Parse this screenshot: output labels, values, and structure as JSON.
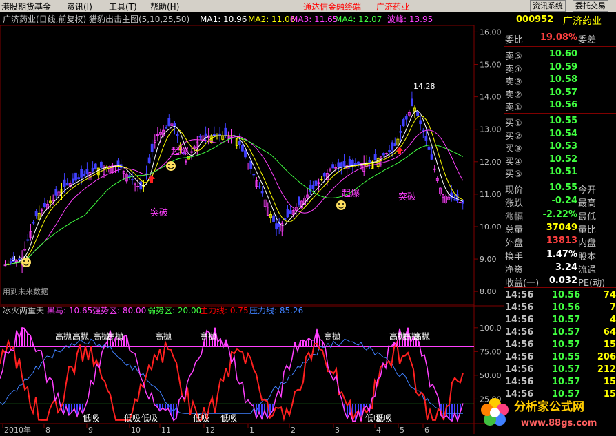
{
  "menu": {
    "items": [
      "港股期货基金",
      "资讯(I)",
      "工具(T)",
      "帮助(H)"
    ],
    "app_title": "通达信金融终端",
    "stock_title": "广济药业",
    "buttons": [
      "资讯系统",
      "委托交易"
    ]
  },
  "main_chart": {
    "header": "广济药业(日线,前复权) 猎豹出击主图(5,10,25,50)",
    "ma1": "MA1: 10.96",
    "ma2": "MA2: 11.06",
    "ma3": "MA3: 11.65",
    "ma4": "MA4: 12.07",
    "wave": "波峰: 13.95",
    "y_ticks": [
      "16.00",
      "15.00",
      "14.00",
      "13.00",
      "12.00",
      "11.00",
      "10.00",
      "9.00",
      "8.00"
    ],
    "y_range": [
      7.6,
      16.2
    ],
    "high_label": "14.28",
    "low_label": "8.50",
    "annotations": [
      "突破",
      "起爆",
      "起爆",
      "突破"
    ],
    "footer_note": "用到未来数据",
    "colors": {
      "up": "#ff40ff",
      "up_alt": "#ffff00",
      "down": "#4040ff",
      "ma1": "#ffffff",
      "ma2": "#ffff00",
      "ma3": "#ff40ff",
      "ma4": "#40ff40",
      "grid": "#800000"
    }
  },
  "sub_chart": {
    "header": "冰火两重天",
    "items": [
      {
        "label": "黑马: 10.65",
        "color": "#ff40ff"
      },
      {
        "label": "强势区: 80.00",
        "color": "#ff40ff"
      },
      {
        "label": "弱势区: 20.00",
        "color": "#40ff40"
      },
      {
        "label": "主力线: 0.75",
        "color": "#ff0000"
      },
      {
        "label": "压力线: 85.26",
        "color": "#4080ff"
      }
    ],
    "y_ticks": [
      "100.0",
      "75.00",
      "50.00",
      "25.00"
    ],
    "y_range": [
      0,
      110
    ],
    "sell_label": "高抛",
    "buy_label": "低吸"
  },
  "x_axis": {
    "labels": [
      "2010年",
      "8",
      "9",
      "10",
      "11",
      "12",
      "1",
      "2",
      "3",
      "4",
      "5",
      "6"
    ]
  },
  "quote": {
    "code": "000952",
    "name": "广济药业",
    "weibi_label": "委比",
    "weibi_value": "19.08%",
    "weicha_label": "委差",
    "sells": [
      {
        "label": "卖⑤",
        "price": "10.60"
      },
      {
        "label": "卖④",
        "price": "10.59"
      },
      {
        "label": "卖③",
        "price": "10.58"
      },
      {
        "label": "卖②",
        "price": "10.57"
      },
      {
        "label": "卖①",
        "price": "10.56"
      }
    ],
    "buys": [
      {
        "label": "买①",
        "price": "10.55"
      },
      {
        "label": "买②",
        "price": "10.54"
      },
      {
        "label": "买③",
        "price": "10.53"
      },
      {
        "label": "买④",
        "price": "10.52"
      },
      {
        "label": "买⑤",
        "price": "10.51"
      }
    ],
    "stats": [
      {
        "label": "现价",
        "value": "10.55",
        "color": "#40ff40",
        "label2": "今开"
      },
      {
        "label": "涨跌",
        "value": "-0.24",
        "color": "#40ff40",
        "label2": "最高"
      },
      {
        "label": "涨幅",
        "value": "-2.22%",
        "color": "#40ff40",
        "label2": "最低"
      },
      {
        "label": "总量",
        "value": "37049",
        "color": "#ffff00",
        "label2": "量比"
      },
      {
        "label": "外盘",
        "value": "13813",
        "color": "#ff4040",
        "label2": "内盘"
      },
      {
        "label": "换手",
        "value": "1.47%",
        "color": "#ffffff",
        "label2": "股本"
      },
      {
        "label": "净资",
        "value": "3.24",
        "color": "#ffffff",
        "label2": "流通"
      },
      {
        "label": "收益(一)",
        "value": "0.032",
        "color": "#ffffff",
        "label2": "PE(动)"
      }
    ],
    "ticks": [
      {
        "time": "14:56",
        "price": "10.56",
        "vol": "74"
      },
      {
        "time": "14:56",
        "price": "10.56",
        "vol": "7"
      },
      {
        "time": "14:56",
        "price": "10.57",
        "vol": "4"
      },
      {
        "time": "14:56",
        "price": "10.57",
        "vol": "64"
      },
      {
        "time": "14:56",
        "price": "10.57",
        "vol": "15"
      },
      {
        "time": "14:56",
        "price": "10.55",
        "vol": "206"
      },
      {
        "time": "14:56",
        "price": "10.57",
        "vol": "212"
      },
      {
        "time": "14:56",
        "price": "10.57",
        "vol": "15"
      },
      {
        "time": "14:56",
        "price": "10.57",
        "vol": "15"
      }
    ]
  },
  "watermark": {
    "name": "分析家公式网",
    "url": "www.88gs.com"
  }
}
